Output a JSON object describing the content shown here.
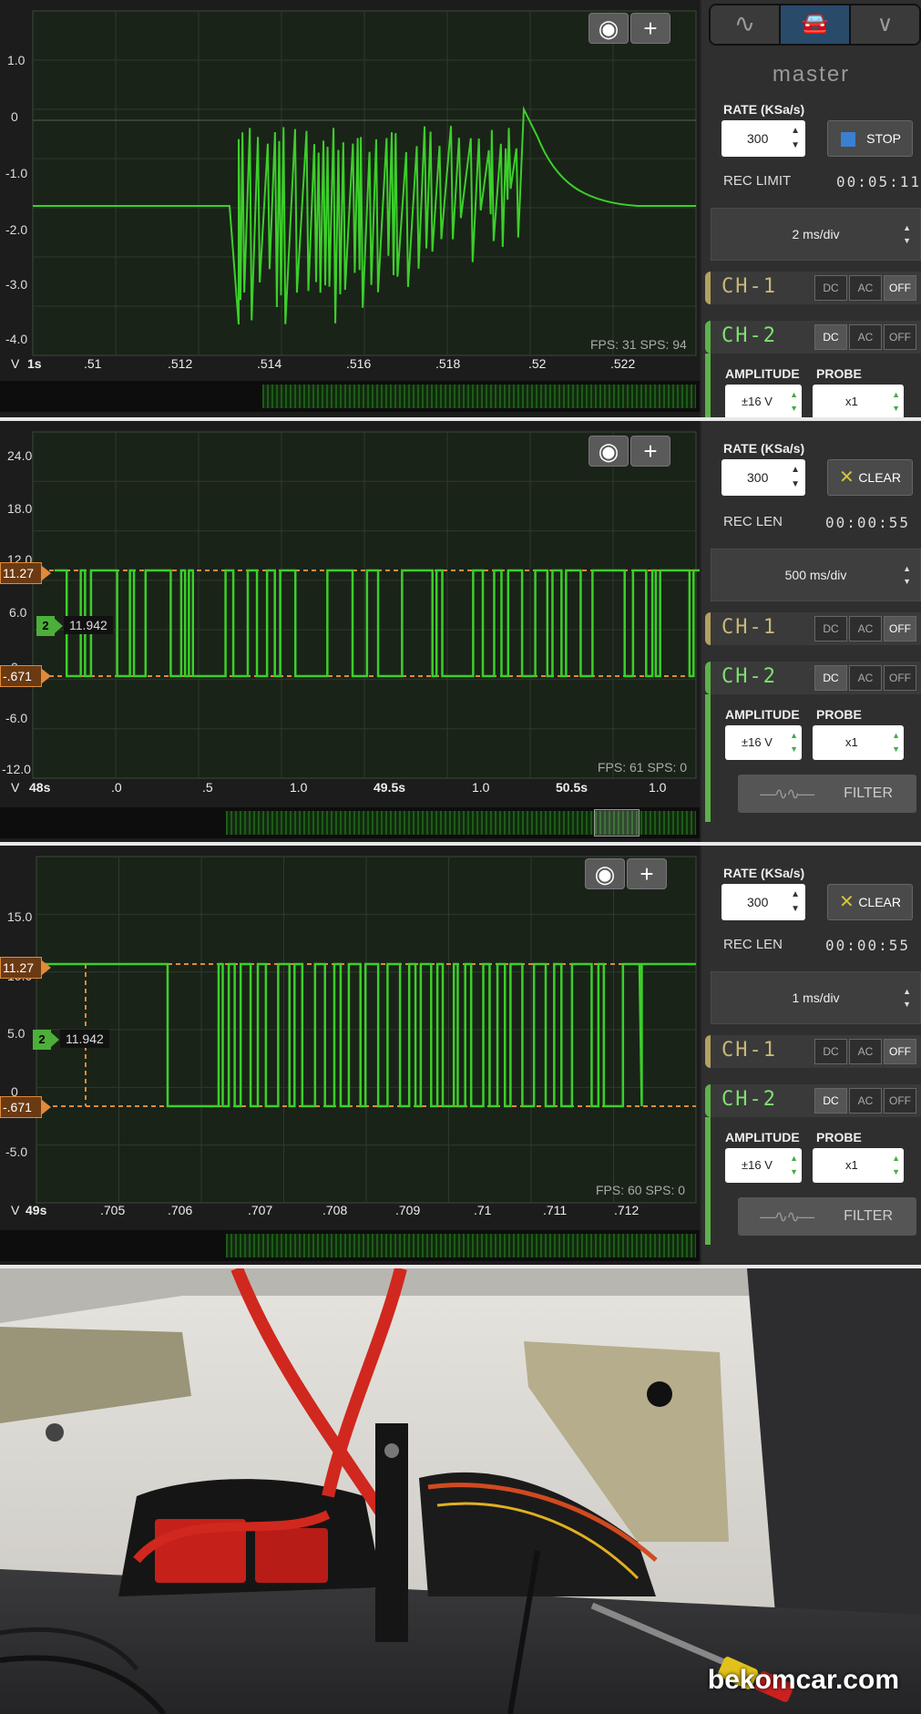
{
  "panel1": {
    "y_ticks": [
      "1.0",
      "0",
      "-1.0",
      "-2.0",
      "-3.0",
      "-4.0"
    ],
    "x_ticks": [
      "V",
      "1s",
      ".51",
      ".512",
      ".514",
      ".516",
      ".518",
      ".52",
      ".522"
    ],
    "fps": "FPS: 31  SPS: 94",
    "mode_tabs": [
      "sine-wave-icon",
      "car-icon",
      "chevron-down-icon"
    ],
    "master_label": "master",
    "rate_label": "RATE (KSa/s)",
    "rate_value": "300",
    "stop_label": "STOP",
    "rec_limit_label": "REC LIMIT",
    "rec_limit_value": "00:05:11",
    "timebase": "2 ms/div",
    "ch1": "CH-1",
    "ch2": "CH-2",
    "coupling": [
      "DC",
      "AC",
      "OFF"
    ],
    "amplitude_label": "AMPLITUDE",
    "probe_label": "PROBE",
    "amplitude": "±16 V",
    "probe": "x1"
  },
  "panel2": {
    "y_ticks": [
      "24.0",
      "18.0",
      "12.0",
      "6.0",
      "0",
      "-6.0",
      "-12.0"
    ],
    "x_ticks": [
      "V",
      "48s",
      ".0",
      ".5",
      "1.0",
      "49.5s",
      "1.0",
      "50.5s",
      "1.0"
    ],
    "fps": "FPS: 61  SPS: 0",
    "cursor_hi": "11.27",
    "cursor_lo": "-.671",
    "ch_marker": "2",
    "ch_value": "11.942",
    "rate_label": "RATE (KSa/s)",
    "rate_value": "300",
    "clear_label": "CLEAR",
    "rec_len_label": "REC LEN",
    "rec_len_value": "00:00:55",
    "timebase": "500 ms/div",
    "ch1": "CH-1",
    "ch2": "CH-2",
    "coupling": [
      "DC",
      "AC",
      "OFF"
    ],
    "amplitude_label": "AMPLITUDE",
    "probe_label": "PROBE",
    "amplitude": "±16 V",
    "probe": "x1",
    "filter_label": "FILTER"
  },
  "panel3": {
    "y_ticks": [
      "15.0",
      "10.0",
      "5.0",
      "0",
      "-5.0"
    ],
    "x_ticks": [
      "V",
      "49s",
      ".705",
      ".706",
      ".707",
      ".708",
      ".709",
      ".71",
      ".711",
      ".712"
    ],
    "fps": "FPS: 60  SPS: 0",
    "cursor_hi": "11.27",
    "cursor_lo": "-.671",
    "ch_marker": "2",
    "ch_value": "11.942",
    "rate_label": "RATE (KSa/s)",
    "rate_value": "300",
    "clear_label": "CLEAR",
    "rec_len_label": "REC LEN",
    "rec_len_value": "00:00:55",
    "timebase": "1 ms/div",
    "ch1": "CH-1",
    "ch2": "CH-2",
    "coupling": [
      "DC",
      "AC",
      "OFF"
    ],
    "amplitude_label": "AMPLITUDE",
    "probe_label": "PROBE",
    "amplitude": "±16 V",
    "probe": "x1",
    "filter_label": "FILTER"
  },
  "photo": {
    "watermark": "bekomcar.com"
  },
  "colors": {
    "trace": "#3ccf2a",
    "cursor": "#e08a3a",
    "grid": "#2e3a2e",
    "plot_bg": "#1a2318"
  }
}
